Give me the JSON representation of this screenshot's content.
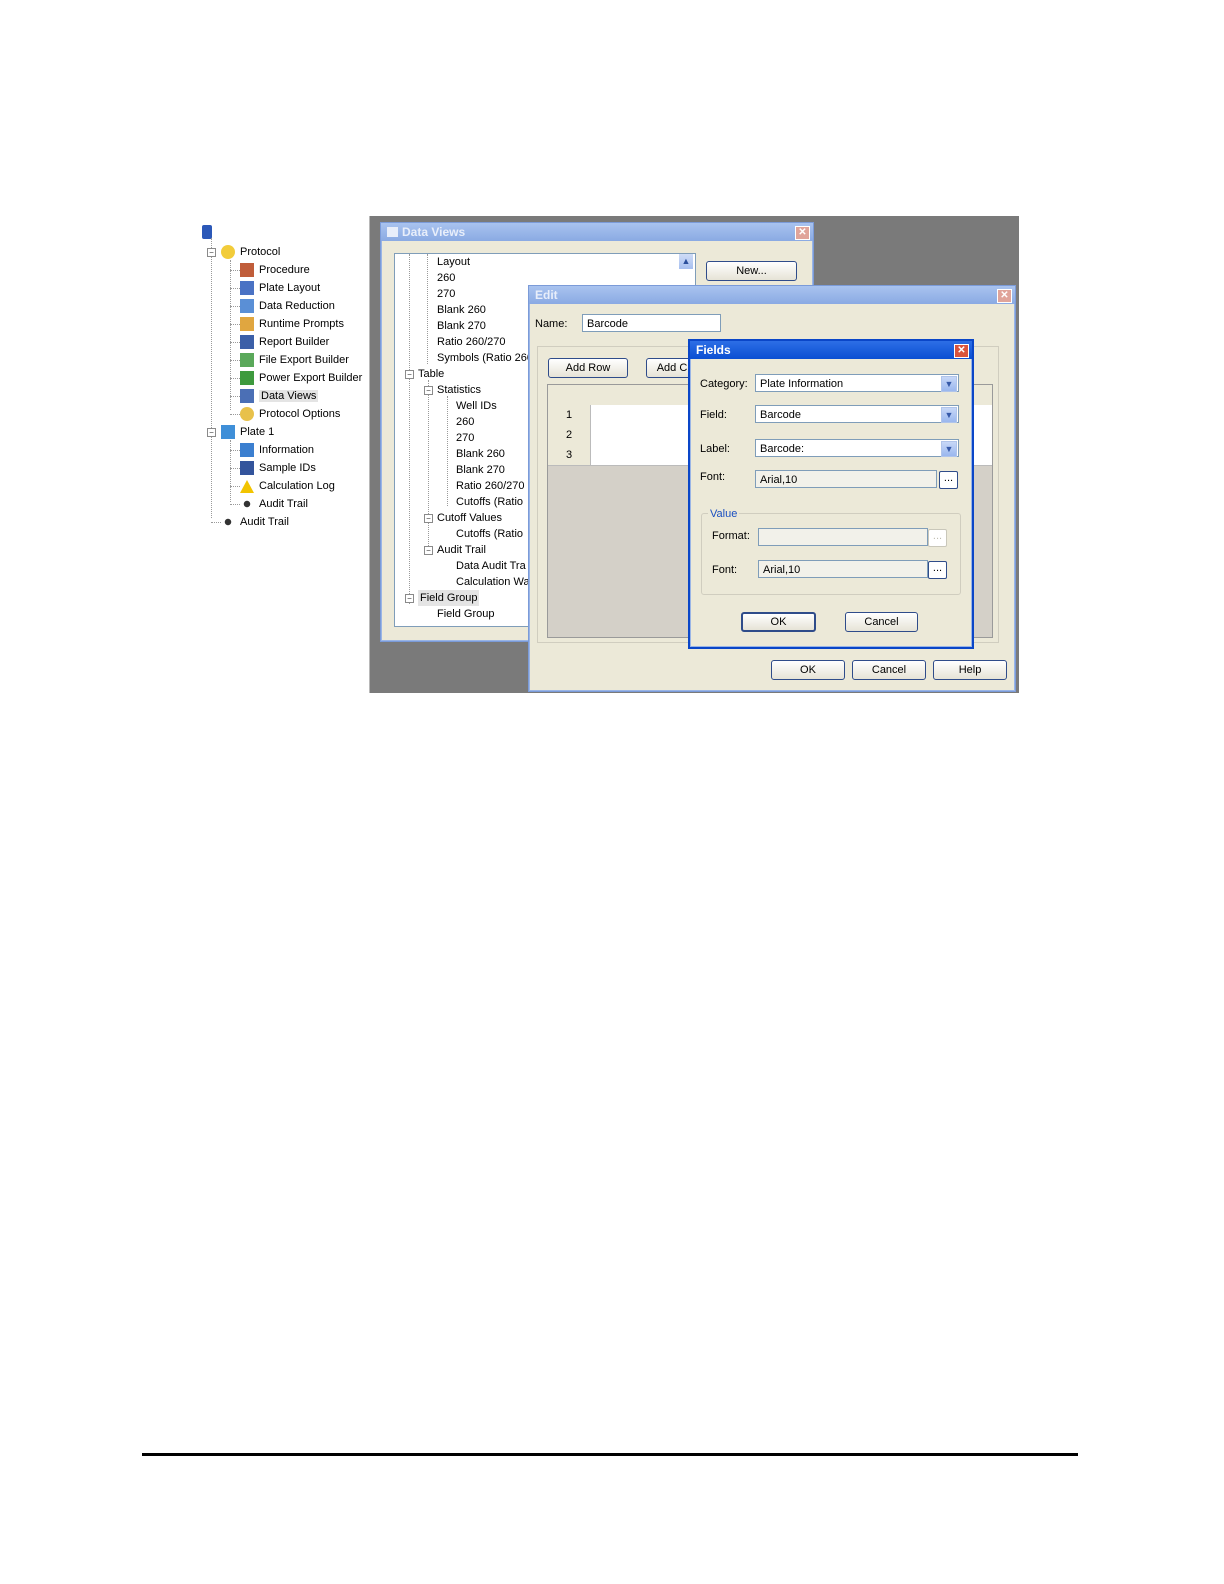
{
  "tree": {
    "protocol": "Protocol",
    "items": [
      "Procedure",
      "Plate Layout",
      "Data Reduction",
      "Runtime Prompts",
      "Report Builder",
      "File Export Builder",
      "Power Export Builder",
      "Data Views",
      "Protocol Options"
    ],
    "plate": "Plate 1",
    "plate_items": [
      "Information",
      "Sample IDs",
      "Calculation Log",
      "Audit Trail"
    ],
    "audit": "Audit Trail"
  },
  "dataviews": {
    "title": "Data Views",
    "new_button": "New...",
    "layout_items": [
      "Layout",
      "260",
      "270",
      "Blank 260",
      "Blank 270",
      "Ratio 260/270",
      "Symbols (Ratio 260"
    ],
    "table_label": "Table",
    "statistics_label": "Statistics",
    "statistics_items": [
      "Well IDs",
      "260",
      "270",
      "Blank 260",
      "Blank 270",
      "Ratio 260/270",
      "Cutoffs (Ratio"
    ],
    "cutoff_label": "Cutoff Values",
    "cutoff_items": [
      "Cutoffs (Ratio"
    ],
    "audit_label": "Audit Trail",
    "audit_items": [
      "Data Audit Tra",
      "Calculation Wa"
    ],
    "fieldgroup_label": "Field Group",
    "fieldgroup_items": [
      "Field Group"
    ]
  },
  "edit": {
    "title": "Edit",
    "name_label": "Name:",
    "name_value": "Barcode",
    "add_row": "Add Row",
    "add_col": "Add C",
    "rows": [
      "1",
      "2",
      "3"
    ],
    "ok": "OK",
    "cancel": "Cancel",
    "help": "Help"
  },
  "fields": {
    "title": "Fields",
    "category_label": "Category:",
    "category_value": "Plate Information",
    "field_label": "Field:",
    "field_value": "Barcode",
    "label_label": "Label:",
    "label_value": "Barcode:",
    "font_label": "Font:",
    "font_value": "Arial,10",
    "value_group": "Value",
    "format_label": "Format:",
    "format_value": "",
    "value_font_label": "Font:",
    "value_font_value": "Arial,10",
    "ellipsis": "...",
    "ok": "OK",
    "cancel": "Cancel"
  }
}
